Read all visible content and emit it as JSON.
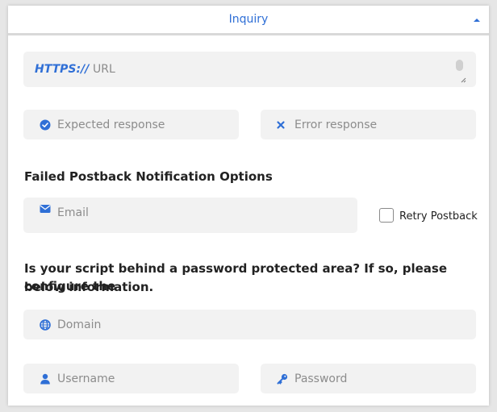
{
  "panel": {
    "title": "Inquiry"
  },
  "url_field": {
    "scheme": "HTTPS://",
    "placeholder": "URL"
  },
  "expected_response": {
    "placeholder": "Expected response"
  },
  "error_response": {
    "placeholder": "Error response"
  },
  "postback_section": {
    "heading": "Failed Postback Notification Options",
    "email_placeholder": "Email",
    "retry_label": "Retry Postback",
    "retry_checked": false
  },
  "auth_section": {
    "heading_line1": "Is your script behind a password protected area? If so, please configure the",
    "heading_line2": "below information.",
    "domain_placeholder": "Domain",
    "username_placeholder": "Username",
    "password_placeholder": "Password"
  },
  "colors": {
    "accent": "#2f6fd6",
    "field_bg": "#f2f2f2",
    "placeholder": "#8c8c8c"
  },
  "icons": {
    "collapse": "caret-up-icon",
    "expected": "check-circle-icon",
    "error": "x-icon",
    "email": "envelope-icon",
    "domain": "globe-icon",
    "username": "user-icon",
    "password": "key-icon"
  }
}
